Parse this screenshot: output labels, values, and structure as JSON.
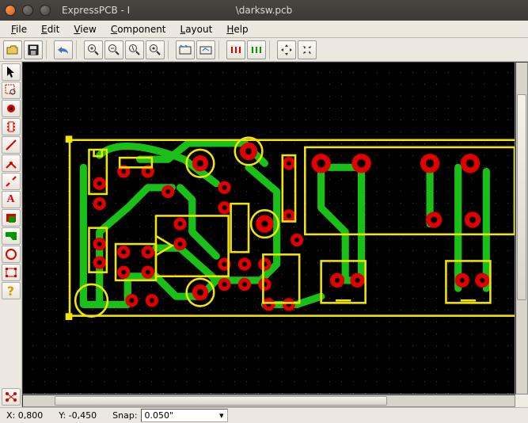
{
  "title_app": "ExpressPCB - I",
  "title_file": "\\darksw.pcb",
  "menu": {
    "file": "File",
    "edit": "Edit",
    "view": "View",
    "component": "Component",
    "layout": "Layout",
    "help": "Help"
  },
  "status": {
    "x_label": "X: 0,800",
    "y_label": "Y: -0,450",
    "snap_label": "Snap:",
    "snap_value": "0.050\""
  },
  "colors": {
    "trace": "#18c018",
    "pad": "#e00000",
    "silk": "#f2e600"
  }
}
